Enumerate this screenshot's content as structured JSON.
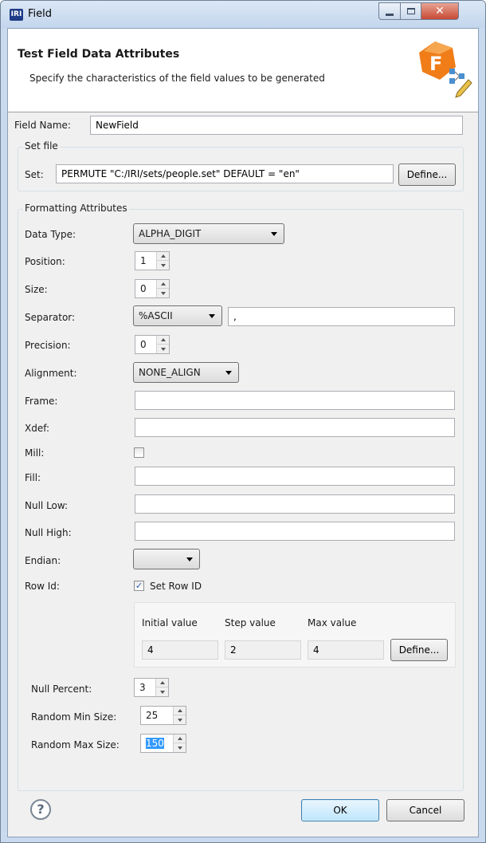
{
  "window": {
    "title": "Field",
    "app_icon_text": "IRI",
    "buttons": {
      "minimize": "minimize-icon",
      "maximize": "maximize-icon",
      "close": "close-icon"
    }
  },
  "banner": {
    "title": "Test Field Data Attributes",
    "description": "Specify the characteristics of the field values to be generated",
    "logo_letter": "F"
  },
  "field_name": {
    "label": "Field Name:",
    "value": "NewField"
  },
  "set_file": {
    "group_label": "Set file",
    "label": "Set:",
    "value": "PERMUTE \"C:/IRI/sets/people.set\" DEFAULT = \"en\"",
    "define_button": "Define..."
  },
  "formatting": {
    "group_label": "Formatting Attributes",
    "data_type": {
      "label": "Data Type:",
      "value": "ALPHA_DIGIT"
    },
    "position": {
      "label": "Position:",
      "value": "1"
    },
    "size": {
      "label": "Size:",
      "value": "0"
    },
    "separator": {
      "label": "Separator:",
      "value": "%ASCII",
      "text": ","
    },
    "precision": {
      "label": "Precision:",
      "value": "0"
    },
    "alignment": {
      "label": "Alignment:",
      "value": "NONE_ALIGN"
    },
    "frame": {
      "label": "Frame:",
      "value": ""
    },
    "xdef": {
      "label": "Xdef:",
      "value": ""
    },
    "mill": {
      "label": "Mill:",
      "checked": false
    },
    "fill": {
      "label": "Fill:",
      "value": ""
    },
    "null_low": {
      "label": "Null Low:",
      "value": ""
    },
    "null_high": {
      "label": "Null High:",
      "value": ""
    },
    "endian": {
      "label": "Endian:",
      "value": ""
    },
    "row_id": {
      "label": "Row Id:",
      "checkbox_label": "Set Row ID",
      "checked": true,
      "initial_label": "Initial value",
      "step_label": "Step value",
      "max_label": "Max value",
      "initial_value": "4",
      "step_value": "2",
      "max_value": "4",
      "define_button": "Define..."
    },
    "null_percent": {
      "label": "Null Percent:",
      "value": "3"
    },
    "random_min_size": {
      "label": "Random Min Size:",
      "value": "25"
    },
    "random_max_size": {
      "label": "Random Max Size:",
      "value": "150"
    }
  },
  "footer": {
    "help_icon": "help-icon",
    "help_glyph": "?",
    "ok_button": "OK",
    "cancel_button": "Cancel"
  },
  "colors": {
    "titlebar": "#c9d9ee",
    "close_button": "#c64a35",
    "selection": "#3399ff",
    "logo_orange": "#f07d18"
  }
}
